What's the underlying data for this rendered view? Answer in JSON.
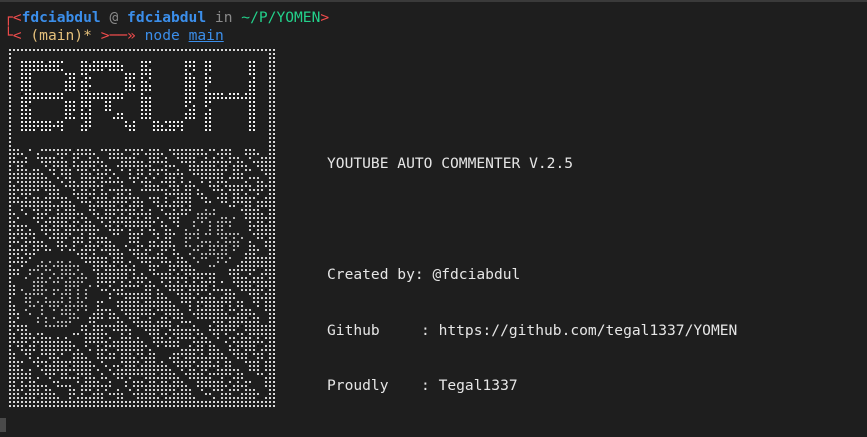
{
  "prompt": {
    "line1_open": "┌<",
    "user": "fdciabdul",
    "at": "@",
    "host": "fdciabdul",
    "in_word": "in",
    "path": "~/P/YOMEN",
    "line1_close": ">",
    "line2_open": "└<",
    "branch": "(main)*",
    "line2_close": ">──»",
    "command": "node",
    "argument": "main"
  },
  "ascii_art": {
    "title": "BRUH"
  },
  "banner": {
    "app_title": "YOUTUBE AUTO COMMENTER V.2.5",
    "rows": [
      {
        "label": "Created by:",
        "value": "@fdciabdul"
      },
      {
        "label": "Github",
        "value": ": https://github.com/tegal1337/YOMEN"
      },
      {
        "label": "Proudly",
        "value": ": Tegal1337"
      }
    ]
  },
  "colors": {
    "background": "#1e1e1e",
    "prompt_red": "#f14c4c",
    "prompt_blue": "#3b8eea",
    "prompt_green": "#23d18b",
    "prompt_yellow": "#e5c07b",
    "text": "#e6e6e6"
  }
}
